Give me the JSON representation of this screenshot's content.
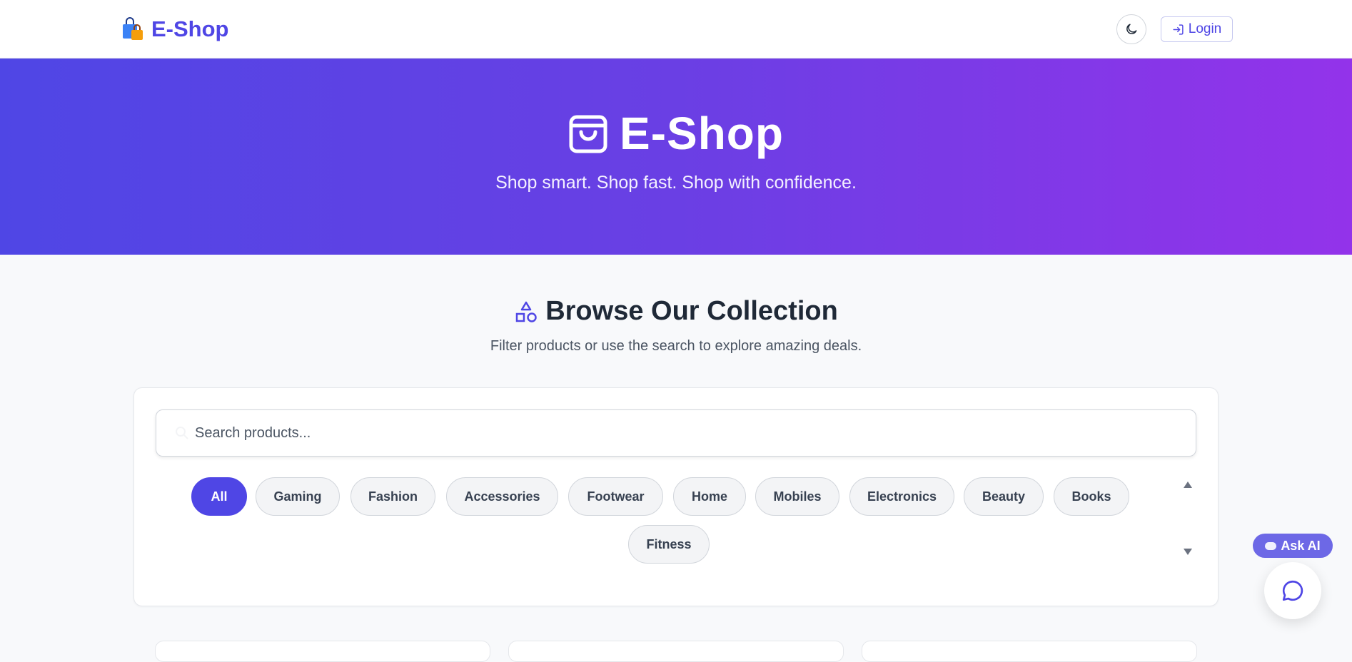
{
  "navbar": {
    "brand": "E-Shop",
    "login_label": "Login"
  },
  "hero": {
    "title": "E-Shop",
    "subtitle": "Shop smart. Shop fast. Shop with confidence."
  },
  "section": {
    "title": "Browse Our Collection",
    "subtitle": "Filter products or use the search to explore amazing deals."
  },
  "search": {
    "placeholder": "Search products...",
    "value": ""
  },
  "categories": [
    {
      "label": "All",
      "active": true
    },
    {
      "label": "Gaming",
      "active": false
    },
    {
      "label": "Fashion",
      "active": false
    },
    {
      "label": "Accessories",
      "active": false
    },
    {
      "label": "Footwear",
      "active": false
    },
    {
      "label": "Home",
      "active": false
    },
    {
      "label": "Mobiles",
      "active": false
    },
    {
      "label": "Electronics",
      "active": false
    },
    {
      "label": "Beauty",
      "active": false
    },
    {
      "label": "Books",
      "active": false
    },
    {
      "label": "Fitness",
      "active": false
    }
  ],
  "assistant": {
    "ask_label": "Ask AI"
  },
  "colors": {
    "accent": "#4f46e5",
    "hero_start": "#4f46e5",
    "hero_end": "#9333ea"
  }
}
